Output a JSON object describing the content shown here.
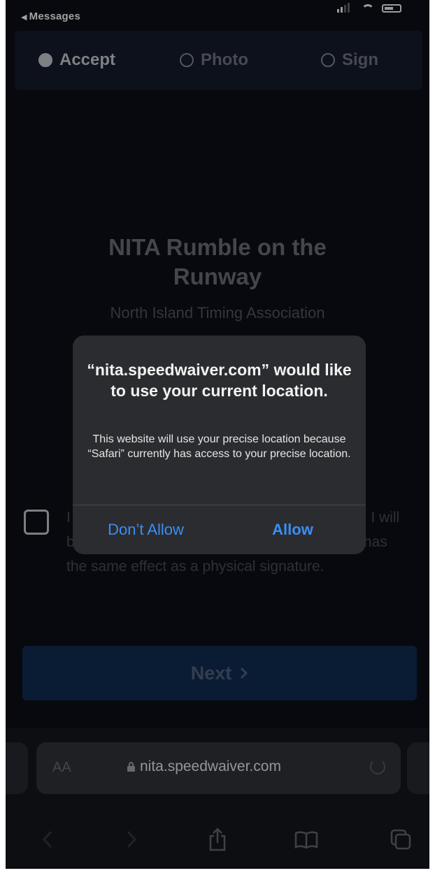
{
  "status_bar": {
    "back_label": "Messages"
  },
  "steps": [
    {
      "label": "Accept",
      "state": "active"
    },
    {
      "label": "Photo",
      "state": "inactive"
    },
    {
      "label": "Sign",
      "state": "inactive"
    }
  ],
  "event": {
    "title": "NITA Rumble on the Runway",
    "organizer": "North Island Timing Association"
  },
  "consent": {
    "checked": false,
    "text": "I ... ure to ... d that by completing this process, I will be electronically signing this document which has the same effect as a physical signature."
  },
  "next_button": {
    "label": "Next",
    "icon": "chevron-right-icon"
  },
  "location_alert": {
    "title": "“nita.speedwaiver.com” would like to use your current location.",
    "message": "This website will use your precise location because “Safari” currently has access to your precise location.",
    "deny_label": "Don’t Allow",
    "allow_label": "Allow",
    "button_color": "#3b8ef3"
  },
  "safari": {
    "text_size_label": "AA",
    "url": "nita.speedwaiver.com",
    "toolbar_icons": [
      "back-icon",
      "forward-icon",
      "share-icon",
      "bookmarks-icon",
      "tabs-icon"
    ]
  },
  "colors": {
    "background": "#0b0d14",
    "steps_bar": "#121725",
    "next_button": "#0e2446",
    "alert_background": "#2b2c30",
    "link_blue": "#3b8ef3"
  }
}
